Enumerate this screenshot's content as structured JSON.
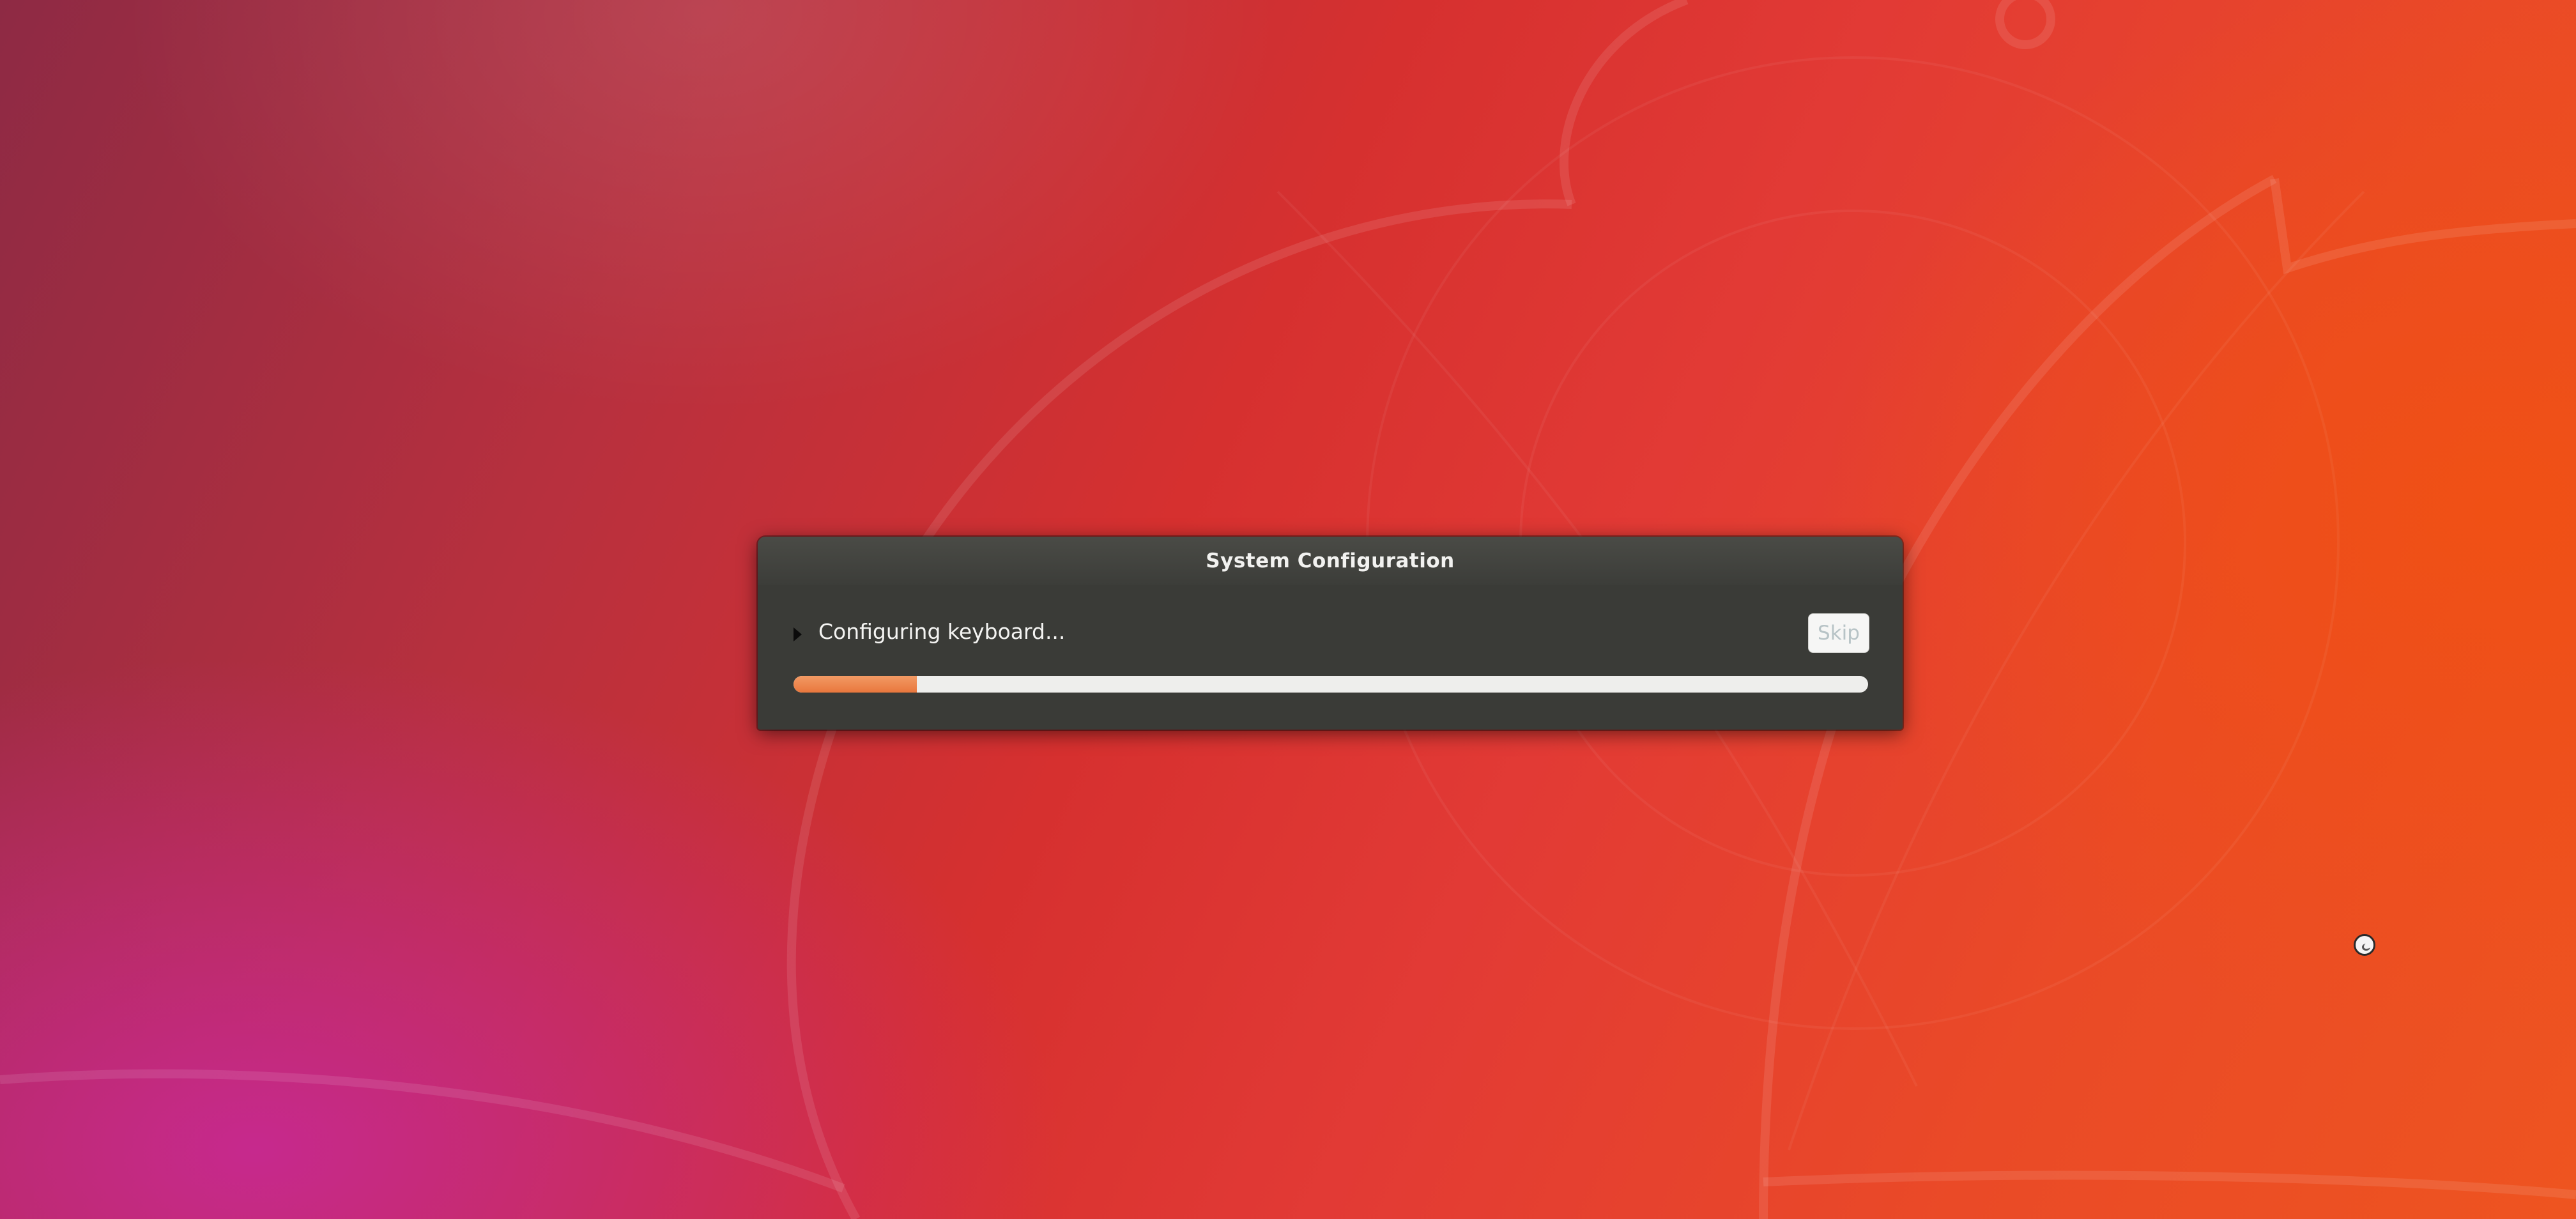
{
  "dialog": {
    "title": "System Configuration",
    "status_text": "Configuring keyboard...",
    "skip_label": "Skip",
    "progress_fraction": 0.115,
    "expander_icon": "triangle-right-icon"
  },
  "desktop": {
    "wallpaper": "ubuntu-gradient-wallpaper",
    "cursor_icon": "busy-cursor-icon"
  },
  "colors": {
    "dialog_bg": "#3a3b37",
    "progress_accent": "#e9773d",
    "skip_text": "#b7c3c6"
  }
}
